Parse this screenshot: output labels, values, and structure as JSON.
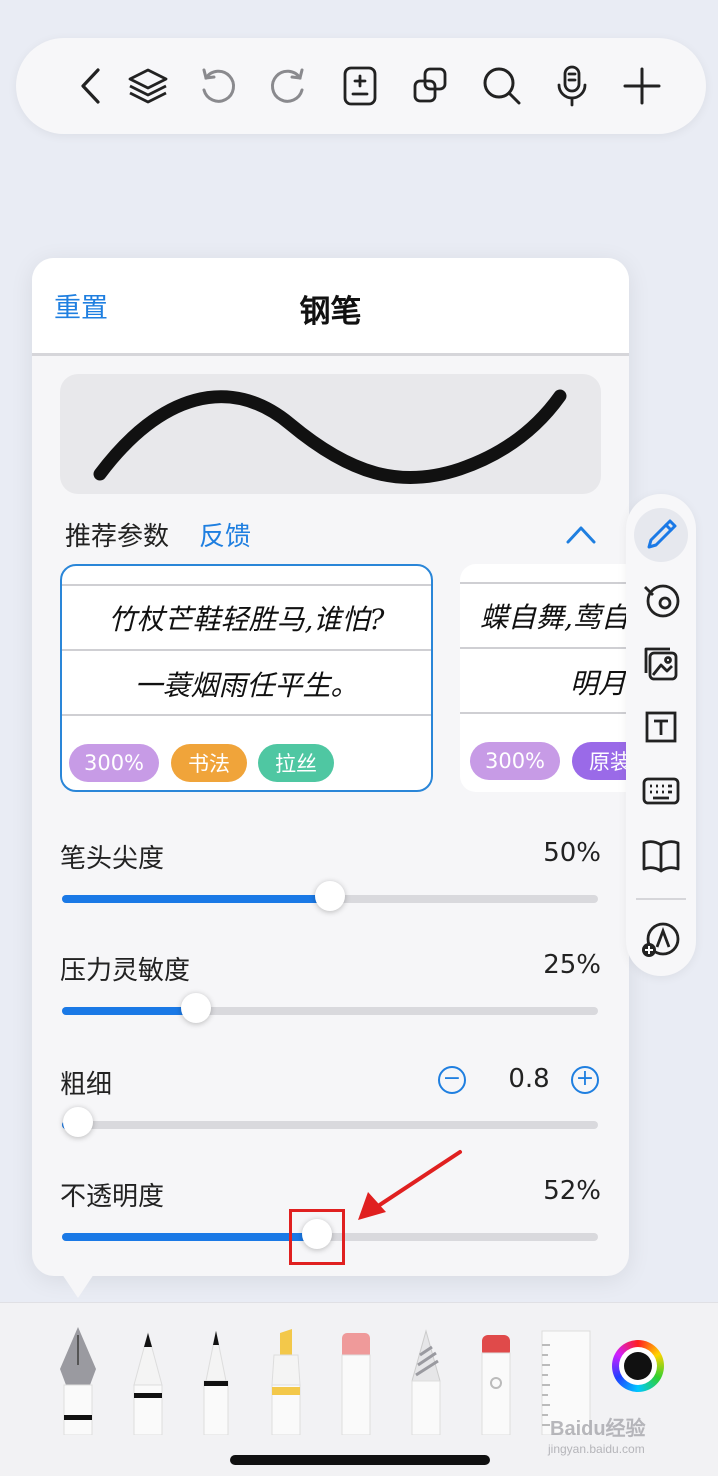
{
  "toolbar": {
    "icons": [
      "back-icon",
      "layers-icon",
      "undo-icon",
      "redo-icon",
      "page-add-icon",
      "copy-icon",
      "search-icon",
      "microphone-icon",
      "add-icon"
    ]
  },
  "panel": {
    "reset_label": "重置",
    "title": "钢笔",
    "recommended_label": "推荐参数",
    "feedback_label": "反馈",
    "presets": [
      {
        "lines": [
          "竹杖芒鞋轻胜马,谁怕?",
          "一蓑烟雨任平生。"
        ],
        "tags": [
          {
            "label": "300%",
            "color": "#c79be6"
          },
          {
            "label": "书法",
            "color": "#f0a43a"
          },
          {
            "label": "拉丝",
            "color": "#4fc7a2"
          }
        ]
      },
      {
        "lines": [
          "蝶自舞,莺自",
          "明月空"
        ],
        "tags": [
          {
            "label": "300%",
            "color": "#c79be6"
          },
          {
            "label": "原装",
            "color": "#9a6ae8"
          }
        ]
      }
    ],
    "sliders": {
      "tip_sharpness": {
        "label": "笔头尖度",
        "value": "50%",
        "level": 0.5
      },
      "pressure": {
        "label": "压力灵敏度",
        "value": "25%",
        "level": 0.25
      },
      "thickness": {
        "label": "粗细",
        "value": "0.8",
        "level": 0.03,
        "minus": "−",
        "plus": "+"
      },
      "opacity": {
        "label": "不透明度",
        "value": "52%",
        "level": 0.475
      }
    }
  },
  "side_rail": {
    "icons": [
      "pen-icon",
      "lasso-icon",
      "image-icon",
      "text-box-icon",
      "keyboard-icon",
      "book-icon",
      "add-tool-icon"
    ]
  },
  "pen_tray": {
    "tools": [
      "fountain-pen",
      "ballpoint-pen",
      "fineliner-pen",
      "highlighter",
      "eraser",
      "pencil",
      "laser-pointer",
      "ruler"
    ],
    "selected_color": "#111111"
  },
  "watermark": {
    "brand": "Baidu经验",
    "url": "jingyan.baidu.com"
  },
  "colors": {
    "accent": "#1a79e6",
    "annotation": "#e02020"
  }
}
